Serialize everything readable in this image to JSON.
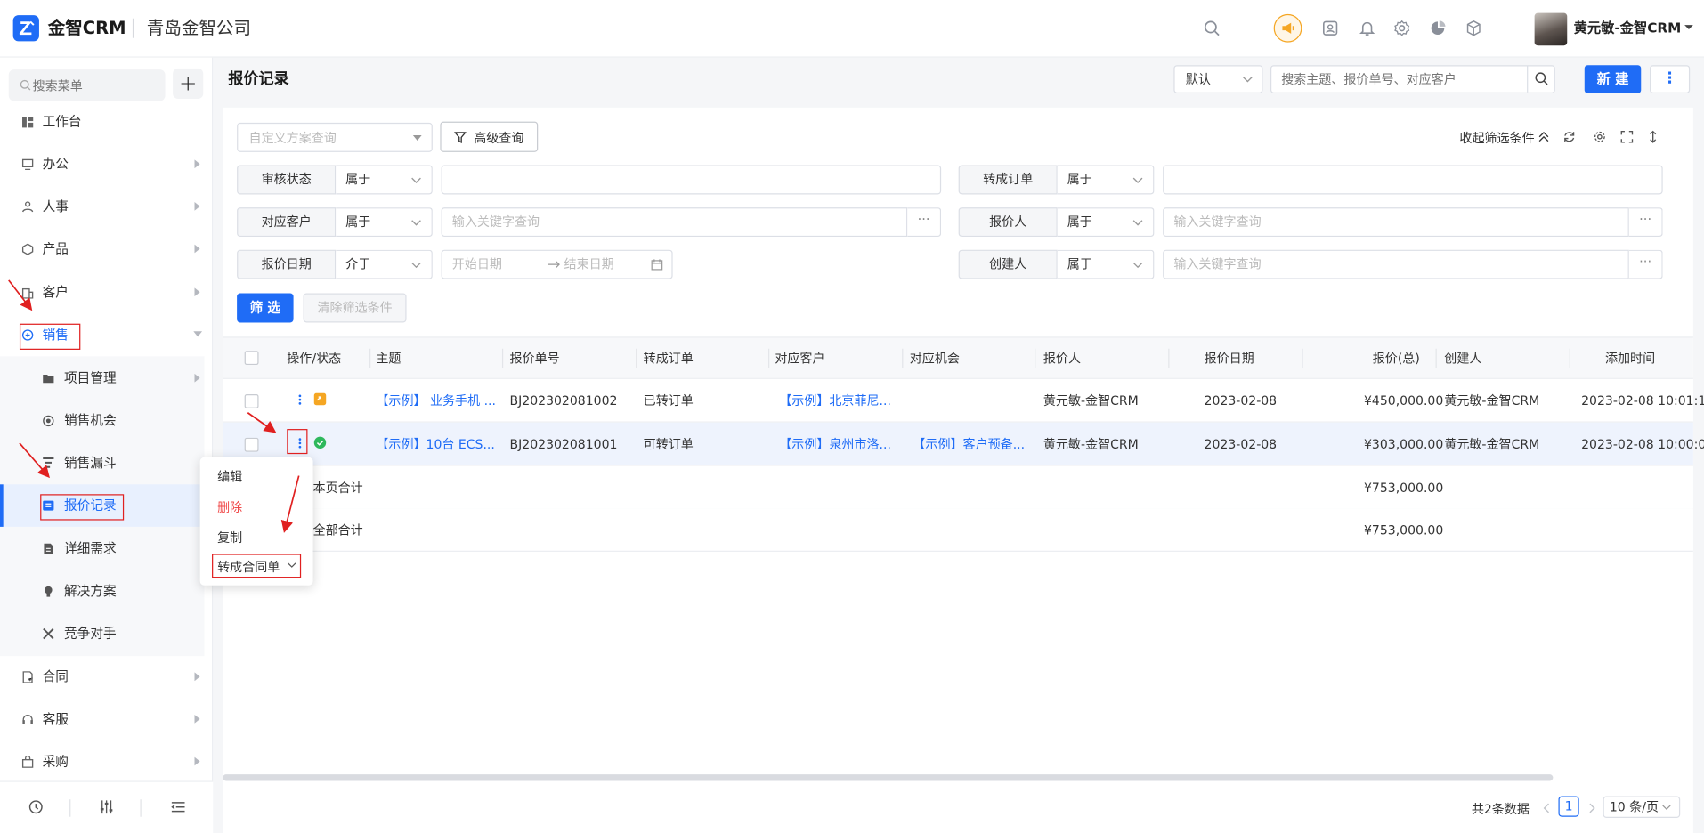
{
  "topbar": {
    "app_name": "金智CRM",
    "company_name": "青岛金智公司",
    "user_name": "黄元敏-金智CRM",
    "icons": [
      "search-icon",
      "speaker-icon",
      "contacts-icon",
      "bell-icon",
      "gear-icon",
      "pie-chart-icon",
      "cube-icon"
    ]
  },
  "sidebar": {
    "search_placeholder": "搜索菜单",
    "add_label": "+",
    "items": [
      {
        "label": "工作台",
        "icon": "dashboard-icon"
      },
      {
        "label": "办公",
        "icon": "monitor-icon"
      },
      {
        "label": "人事",
        "icon": "people-icon"
      },
      {
        "label": "产品",
        "icon": "box-icon"
      },
      {
        "label": "客户",
        "icon": "building-icon"
      },
      {
        "label": "销售",
        "icon": "sales-icon"
      },
      {
        "label": "合同",
        "icon": "contract-icon"
      },
      {
        "label": "客服",
        "icon": "headset-icon"
      },
      {
        "label": "采购",
        "icon": "bag-icon"
      }
    ],
    "sales_children": [
      {
        "label": "项目管理",
        "icon": "folder-icon"
      },
      {
        "label": "销售机会",
        "icon": "target-icon"
      },
      {
        "label": "销售漏斗",
        "icon": "funnel-icon"
      },
      {
        "label": "报价记录",
        "icon": "quote-icon"
      },
      {
        "label": "详细需求",
        "icon": "doc-icon"
      },
      {
        "label": "解决方案",
        "icon": "bulb-icon"
      },
      {
        "label": "竞争对手",
        "icon": "versus-icon"
      }
    ],
    "accent_color": "#1f6cf6"
  },
  "header": {
    "title": "报价记录",
    "view_select": "默认",
    "search_placeholder": "搜索主题、报价单号、对应客户",
    "new_label": "新 建",
    "more_label": "⋮"
  },
  "filters": {
    "scheme_placeholder": "自定义方案查询",
    "advanced_label": "高级查询",
    "collapse_label": "收起筛选条件",
    "rows": [
      {
        "label": "审核状态",
        "op": "属于",
        "value": ""
      },
      {
        "label": "转成订单",
        "op": "属于",
        "value": ""
      },
      {
        "label": "对应客户",
        "op": "属于",
        "value": "输入关键字查询"
      },
      {
        "label": "报价人",
        "op": "属于",
        "value": "输入关键字查询"
      },
      {
        "label": "报价日期",
        "op": "介于",
        "value": "开始日期"
      },
      {
        "label": "创建人",
        "op": "属于",
        "value": "输入关键字查询"
      }
    ],
    "date_end": "结束日期",
    "more_dots": "···",
    "apply_label": "筛 选",
    "clear_label": "清除筛选条件"
  },
  "table": {
    "columns": [
      "操作/状态",
      "主题",
      "报价单号",
      "转成订单",
      "对应客户",
      "对应机会",
      "报价人",
      "报价日期",
      "报价(总)",
      "创建人",
      "添加时间"
    ],
    "rows": [
      {
        "subject": "【示例】 业务手机 ...",
        "number": "BJ202302081002",
        "order": "已转订单",
        "customer": "【示例】北京菲尼...",
        "opportunity": "",
        "quoter": "黄元敏-金智CRM",
        "date": "2023-02-08",
        "total": "¥450,000.00",
        "creator": "黄元敏-金智CRM",
        "added": "2023-02-08 10:01:1"
      },
      {
        "subject": "【示例】10台 ECS...",
        "number": "BJ202302081001",
        "order": "可转订单",
        "customer": "【示例】泉州市洛...",
        "opportunity": "【示例】客户预备...",
        "quoter": "黄元敏-金智CRM",
        "date": "2023-02-08",
        "total": "¥303,000.00",
        "creator": "黄元敏-金智CRM",
        "added": "2023-02-08 10:00:0"
      }
    ],
    "page_sum_label": "本页合计",
    "page_sum_value": "¥753,000.00",
    "all_sum_label": "全部合计",
    "all_sum_value": "¥753,000.00"
  },
  "context_menu": {
    "items": [
      "编辑",
      "删除",
      "复制",
      "转成合同单"
    ],
    "delete_color": "#f04a4a"
  },
  "pager": {
    "total": "共2条数据",
    "page": "1",
    "size": "10 条/页"
  }
}
